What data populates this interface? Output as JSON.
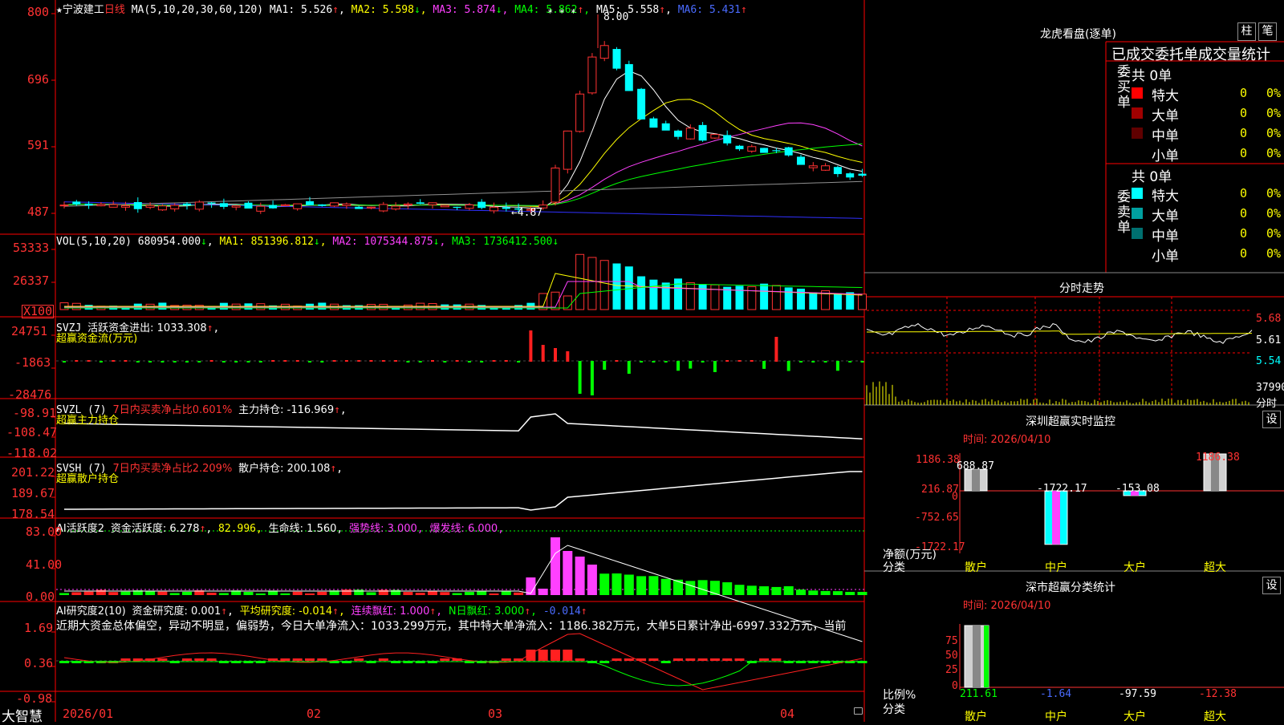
{
  "colors": {
    "up": "#ff3232",
    "down": "#00ffff",
    "ma1": "#ffffff",
    "ma2": "#ffff00",
    "ma3": "#ff40ff",
    "ma4": "#00ff00",
    "ma5": "#404040",
    "ma6": "#3030ff",
    "frame": "#ff0000",
    "buy": "#ff2020",
    "sell": "#00ff00",
    "active": "#ff40ff"
  },
  "main": {
    "header": {
      "star": "★",
      "name": "宁波建工",
      "period": "日线",
      "ma_def": "MA(5,10,20,30,60,120)",
      "ma1": "MA1: 5.526",
      "ma1_arrow": "↑",
      "ma2": "MA2: 5.598",
      "ma2_arrow": "↓",
      "ma3": "MA3: 5.874",
      "ma3_arrow": "↓",
      "ma4": "MA4: 5.862",
      "ma4_arrow": "↑",
      "ma5": "MA5: 5.558",
      "ma5_arrow": "↑",
      "ma6": "MA6: 5.431",
      "ma6_arrow": "↑"
    },
    "high_label": "8.00",
    "low_label": "←4.87",
    "marks": "* * *",
    "y_labels": [
      "800",
      "696",
      "591",
      "487"
    ]
  },
  "volume": {
    "header": {
      "def": "VOL(5,10,20)",
      "value": "680954.000",
      "arrow": "↓",
      "ma1": "MA1: 851396.812",
      "ma1_arrow": "↓",
      "ma2": "MA2: 1075344.875",
      "ma2_arrow": "↓",
      "ma3": "MA3: 1736412.500",
      "ma3_arrow": "↓"
    },
    "y_labels": [
      "53333",
      "26337"
    ],
    "unit": "X100"
  },
  "svzj": {
    "header": {
      "name": "SVZJ",
      "label": "活跃资金进出: 1033.308",
      "arrow": "↑",
      "sep": ",",
      "sub": "超赢资金流(万元)"
    },
    "y_labels": [
      "24751",
      "-1863",
      "-28476"
    ]
  },
  "svzl": {
    "header": {
      "name": "SVZL (7)",
      "ratio": "7日内买卖净占比0.601%",
      "label": "主力持仓: -116.969",
      "arrow": "↑",
      "sep": ",",
      "sub": "超赢主力持仓"
    },
    "y_labels": [
      "-98.91",
      "-108.47",
      "-118.02"
    ]
  },
  "svsh": {
    "header": {
      "name": "SVSH (7)",
      "ratio": "7日内买卖净占比2.209%",
      "label": "散户持仓: 200.108",
      "arrow": "↑",
      "sep": ",",
      "sub": "超赢散户持仓"
    },
    "y_labels": [
      "201.22",
      "189.67",
      "178.54"
    ]
  },
  "ai2": {
    "header": {
      "name": "AI活跃度2",
      "label": "资金活跃度: 6.278",
      "arrow": "↑",
      "v2": "82.996",
      "life": "生命线: 1.560",
      "strong": "强势线: 3.000",
      "burst": "爆发线: 6.000"
    },
    "y_labels": [
      "83.00",
      "41.00",
      "0.00"
    ]
  },
  "ai3": {
    "header": {
      "name": "AI研究度2(10)",
      "label": "资金研究度: 0.001",
      "arrow": "↑",
      "avg": "平均研究度: -0.014",
      "avg_arrow": "↑",
      "red": "连续飘红: 1.000",
      "red_arrow": "↑",
      "nred": "N日飘红: 3.000",
      "nred_arrow": "↑",
      "neg": "-0.014",
      "neg_arrow": "↑"
    },
    "comment": "近期大资金总体偏空，异动不明显，偏弱势，今日大单净流入：1033.299万元，其中特大单净流入：1186.382万元，大单5日累计净出-6997.332万元，当前",
    "y_labels": [
      "1.69",
      "0.36",
      "-0.98"
    ]
  },
  "footer": {
    "brand": "大智慧",
    "dates": [
      "2026/01",
      "02",
      "03",
      "04"
    ]
  },
  "right": {
    "lhb_title": "龙虎看盘(逐单)",
    "btn_zhu": "柱",
    "btn_bi": "笔",
    "stat_title": "已成交委托单成交量统计",
    "buy": {
      "side": "委买单",
      "total": "共 0单",
      "rows": [
        {
          "name": "特大",
          "val": "0",
          "pct": "0%"
        },
        {
          "name": "大单",
          "val": "0",
          "pct": "0%"
        },
        {
          "name": "中单",
          "val": "0",
          "pct": "0%"
        },
        {
          "name": "小单",
          "val": "0",
          "pct": "0%"
        }
      ]
    },
    "sell": {
      "side": "委卖单",
      "total": "共 0单",
      "rows": [
        {
          "name": "特大",
          "val": "0",
          "pct": "0%"
        },
        {
          "name": "大单",
          "val": "0",
          "pct": "0%"
        },
        {
          "name": "中单",
          "val": "0",
          "pct": "0%"
        },
        {
          "name": "小单",
          "val": "0",
          "pct": "0%"
        }
      ]
    },
    "intraday": {
      "title": "分时走势",
      "prices": [
        "5.68",
        "5.61",
        "5.54"
      ],
      "vol": "37990",
      "unit": "分时"
    },
    "monitor": {
      "title": "深圳超赢实时监控",
      "set": "设",
      "time": "时间: 2026/04/10",
      "y_labels": [
        "1186.38",
        "216.87",
        "0",
        "-752.65",
        "-1722.17"
      ],
      "unit1": "净额(万元)",
      "unit2": "分类",
      "cats": [
        "散户",
        "中户",
        "大户",
        "超大"
      ],
      "values": [
        "688.87",
        "-1722.17",
        "-153.08",
        "1186.38"
      ]
    },
    "classify": {
      "title": "深市超赢分类统计",
      "set": "设",
      "time": "时间: 2026/04/10",
      "y_labels": [
        "75",
        "50",
        "25",
        "0"
      ],
      "unit1": "比例%",
      "unit2": "分类",
      "cats": [
        "散户",
        "中户",
        "大户",
        "超大"
      ],
      "values": [
        "211.61",
        "-1.64",
        "-97.59",
        "-12.38"
      ]
    }
  }
}
